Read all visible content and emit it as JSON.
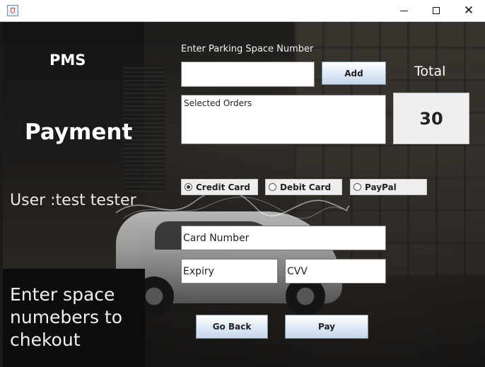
{
  "window": {
    "title": "",
    "controls": {
      "minimize": "minimize-icon",
      "maximize": "maximize-icon",
      "close": "close-icon"
    }
  },
  "left_panel": {
    "app_name": "PMS",
    "page_heading": "Payment",
    "user_text": "User :test tester",
    "hint_text": "Enter space numebers to chekout"
  },
  "form": {
    "space_label": "Enter Parking Space Number",
    "space_input_value": "",
    "add_button": "Add",
    "orders_placeholder": "Selected Orders",
    "total_label": "Total",
    "total_value": "30",
    "payment_methods": [
      {
        "label": "Credit Card",
        "selected": true
      },
      {
        "label": "Debit Card",
        "selected": false
      },
      {
        "label": "PayPal",
        "selected": false
      }
    ],
    "card_number_placeholder": "Card Number",
    "expiry_placeholder": "Expiry",
    "cvv_placeholder": "CVV",
    "back_button": "Go Back",
    "pay_button": "Pay"
  }
}
